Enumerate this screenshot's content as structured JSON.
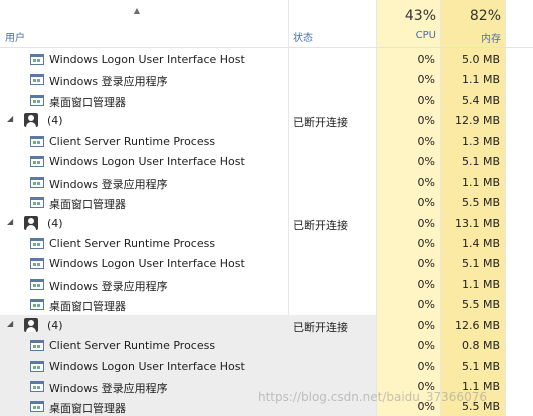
{
  "header": {
    "user_label": "用户",
    "status_label": "状态",
    "cpu_pct": "43%",
    "cpu_label": "CPU",
    "mem_pct": "82%",
    "mem_label": "内存"
  },
  "rows": [
    {
      "type": "proc",
      "name": "Windows Logon User Interface Host",
      "status": "",
      "cpu": "0%",
      "mem": "5.0 MB"
    },
    {
      "type": "proc",
      "name": "Windows 登录应用程序",
      "status": "",
      "cpu": "0%",
      "mem": "1.1 MB"
    },
    {
      "type": "proc",
      "name": "桌面窗口管理器",
      "status": "",
      "cpu": "0%",
      "mem": "5.4 MB"
    },
    {
      "type": "group",
      "name": "(4)",
      "status": "已断开连接",
      "cpu": "0%",
      "mem": "12.9 MB"
    },
    {
      "type": "proc",
      "name": "Client Server Runtime Process",
      "status": "",
      "cpu": "0%",
      "mem": "1.3 MB"
    },
    {
      "type": "proc",
      "name": "Windows Logon User Interface Host",
      "status": "",
      "cpu": "0%",
      "mem": "5.1 MB"
    },
    {
      "type": "proc",
      "name": "Windows 登录应用程序",
      "status": "",
      "cpu": "0%",
      "mem": "1.1 MB"
    },
    {
      "type": "proc",
      "name": "桌面窗口管理器",
      "status": "",
      "cpu": "0%",
      "mem": "5.5 MB"
    },
    {
      "type": "group",
      "name": "(4)",
      "status": "已断开连接",
      "cpu": "0%",
      "mem": "13.1 MB"
    },
    {
      "type": "proc",
      "name": "Client Server Runtime Process",
      "status": "",
      "cpu": "0%",
      "mem": "1.4 MB"
    },
    {
      "type": "proc",
      "name": "Windows Logon User Interface Host",
      "status": "",
      "cpu": "0%",
      "mem": "5.1 MB"
    },
    {
      "type": "proc",
      "name": "Windows 登录应用程序",
      "status": "",
      "cpu": "0%",
      "mem": "1.1 MB"
    },
    {
      "type": "proc",
      "name": "桌面窗口管理器",
      "status": "",
      "cpu": "0%",
      "mem": "5.5 MB"
    },
    {
      "type": "group",
      "name": "(4)",
      "status": "已断开连接",
      "cpu": "0%",
      "mem": "12.6 MB",
      "highlight": true
    },
    {
      "type": "proc",
      "name": "Client Server Runtime Process",
      "status": "",
      "cpu": "0%",
      "mem": "0.8 MB",
      "highlight": true
    },
    {
      "type": "proc",
      "name": "Windows Logon User Interface Host",
      "status": "",
      "cpu": "0%",
      "mem": "5.1 MB",
      "highlight": true
    },
    {
      "type": "proc",
      "name": "Windows 登录应用程序",
      "status": "",
      "cpu": "0%",
      "mem": "1.1 MB",
      "highlight": true
    },
    {
      "type": "proc",
      "name": "桌面窗口管理器",
      "status": "",
      "cpu": "0%",
      "mem": "5.5 MB",
      "highlight": true
    }
  ],
  "watermark": "https://blog.csdn.net/baidu_37366076"
}
